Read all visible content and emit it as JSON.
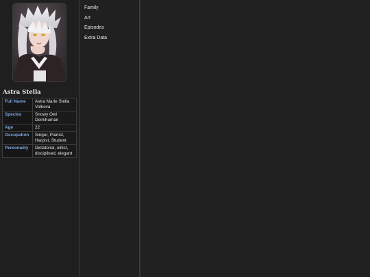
{
  "profile": {
    "name": "Astra Stella",
    "rows": [
      {
        "key": "Full Name",
        "value": "Astra Marie Stella Volkova"
      },
      {
        "key": "Species",
        "value": "Snowy Owl Demihuman"
      },
      {
        "key": "Age",
        "value": "22"
      },
      {
        "key": "Occupation",
        "value": "Singer, Pianist, Harpist, Student"
      },
      {
        "key": "Personality",
        "value": "Dictatorial, elitist, disciplined, elegant"
      }
    ]
  },
  "nav": {
    "items": [
      "Family",
      "Art",
      "Episodes",
      "Extra Data"
    ]
  }
}
